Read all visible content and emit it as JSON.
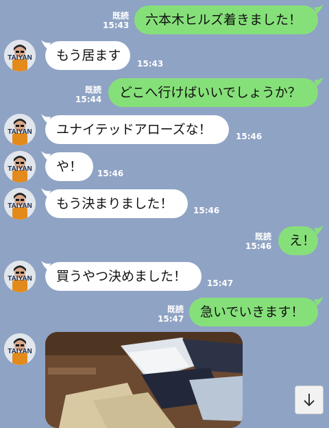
{
  "messages": [
    {
      "side": "out",
      "text": "六本木ヒルズ着きました！",
      "time": "15:43",
      "read": "既読"
    },
    {
      "side": "in",
      "text": "もう居ます",
      "time": "15:43"
    },
    {
      "side": "out",
      "text": "どこへ行けばいいでしょうか？",
      "time": "15:44",
      "read": "既読"
    },
    {
      "side": "in",
      "text": "ユナイテッドアローズな！",
      "time": "15:46"
    },
    {
      "side": "in",
      "text": "や！",
      "time": "15:46"
    },
    {
      "side": "in",
      "text": "もう決まりました！",
      "time": "15:46"
    },
    {
      "side": "out",
      "text": "え！",
      "time": "15:46",
      "read": "既読"
    },
    {
      "side": "in",
      "text": "買うやつ決めました！",
      "time": "15:47"
    },
    {
      "side": "out",
      "text": "急いでいきます！",
      "time": "15:47",
      "read": "既読"
    }
  ],
  "avatar_text": "TAIYAN",
  "photo_message": {
    "icon": "clothing-photo"
  },
  "scroll_button": {
    "icon": "arrow-down-icon"
  },
  "colors": {
    "background": "#8fa3c4",
    "incoming_bubble": "#ffffff",
    "outgoing_bubble": "#86e07a",
    "meta_text": "#ffffff"
  }
}
